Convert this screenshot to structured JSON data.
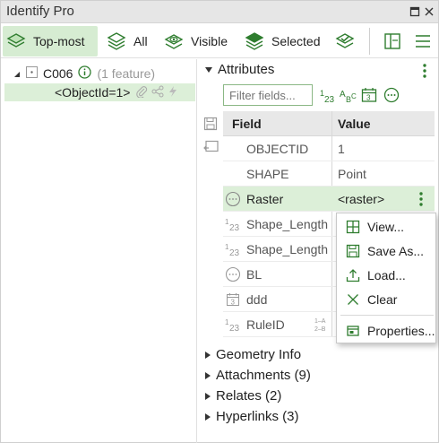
{
  "window": {
    "title": "Identify Pro"
  },
  "colors": {
    "accent": "#3c9a3c",
    "selected_row": "#dcefd8"
  },
  "toolbar": {
    "top_most": "Top-most",
    "all": "All",
    "visible": "Visible",
    "selected": "Selected"
  },
  "tree": {
    "layer": "C006",
    "count": "(1 feature)",
    "feature": "<ObjectId=1>"
  },
  "attributes": {
    "title": "Attributes",
    "filter_placeholder": "Filter fields...",
    "col_field": "Field",
    "col_value": "Value",
    "rows": [
      {
        "field": "OBJECTID",
        "value": "1",
        "icon": "none"
      },
      {
        "field": "SHAPE",
        "value": "Point",
        "icon": "none"
      },
      {
        "field": "Raster",
        "value": "<raster>",
        "icon": "raster-icon"
      },
      {
        "field": "Shape_Length",
        "value": "",
        "icon": "numeric-icon"
      },
      {
        "field": "Shape_Length",
        "value": "",
        "icon": "numeric-icon"
      },
      {
        "field": "BL",
        "value": "",
        "icon": "blob-icon"
      },
      {
        "field": "ddd",
        "value": "",
        "icon": "date-icon"
      },
      {
        "field": "RuleID",
        "value": "",
        "icon": "numeric-icon"
      }
    ]
  },
  "context_menu": {
    "view": "View...",
    "save_as": "Save As...",
    "load": "Load...",
    "clear": "Clear",
    "properties": "Properties..."
  },
  "sections": {
    "geometry": "Geometry Info",
    "attachments": "Attachments (9)",
    "relates": "Relates (2)",
    "hyperlinks": "Hyperlinks (3)"
  }
}
